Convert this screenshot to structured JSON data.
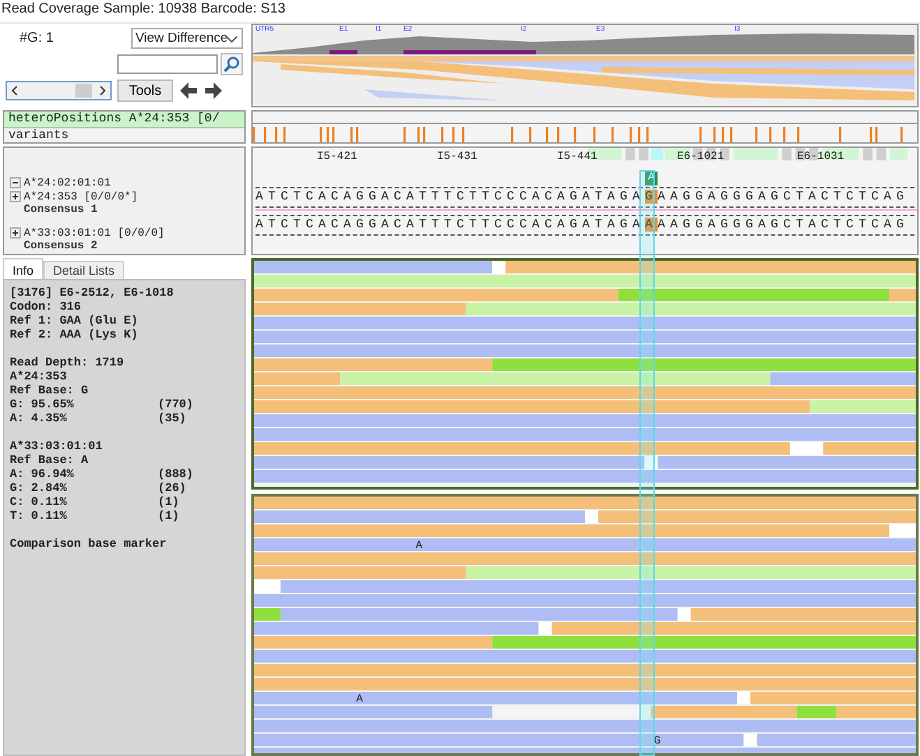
{
  "title": "Read Coverage Sample: 10938 Barcode: S13",
  "group_count": "#G: 1",
  "view_select": "View Difference",
  "tools_button": "Tools",
  "overview_markers": [
    "UTR5",
    "E1",
    "I1",
    "E2",
    "I2",
    "E3",
    "I3"
  ],
  "hetero": {
    "line1": "heteroPositions A*24:353 [0/",
    "line2": "variants"
  },
  "alleles": [
    {
      "label": "A*24:02:01:01",
      "expanded": true
    },
    {
      "label": "A*24:353 [0/0/0*]",
      "expanded": false,
      "consensus": "Consensus 1"
    },
    {
      "label": "A*33:03:01:01 [0/0/0]",
      "expanded": false,
      "consensus": "Consensus 2"
    }
  ],
  "ruler": [
    "I5-421",
    "I5-431",
    "I5-441",
    "E6-1021",
    "E6-1031"
  ],
  "variant_base": "A",
  "consensus": [
    {
      "before": "ATCTCACAGGACATTTCTTCCCACAGATAGA",
      "base": "G",
      "after": "AAGGAGGGAGCTACTCTCAG"
    },
    {
      "before": "ATCTCACAGGACATTTCTTCCCACAGATAGA",
      "base": "A",
      "after": "AAGGAGGGAGCTACTCTCAG"
    }
  ],
  "tabs": [
    {
      "label": "Info",
      "selected": true
    },
    {
      "label": "Detail Lists",
      "selected": false
    }
  ],
  "info": [
    [
      {
        "text": "[3176] E6-2512, E6-1018"
      },
      {
        "text": "Codon: 316"
      },
      {
        "text": "Ref 1: GAA (Glu E)"
      },
      {
        "text": "Ref 2: AAA (Lys K)"
      }
    ],
    [
      {
        "text": "Read Depth: 1719"
      },
      {
        "text": "A*24:353"
      },
      {
        "text": "Ref Base: G"
      },
      {
        "text": "G: 95.65%",
        "count": "(770)"
      },
      {
        "text": "A: 4.35%",
        "count": "(35)"
      }
    ],
    [
      {
        "text": "A*33:03:01:01"
      },
      {
        "text": "Ref Base: A"
      },
      {
        "text": "A: 96.94%",
        "count": "(888)"
      },
      {
        "text": "G: 2.84%",
        "count": "(26)"
      },
      {
        "text": "C: 0.11%",
        "count": "(1)"
      },
      {
        "text": "T: 0.11%",
        "count": "(1)"
      }
    ],
    [
      {
        "text": "Comparison base marker"
      }
    ]
  ],
  "read_marks": [
    "A",
    "A",
    "G"
  ]
}
